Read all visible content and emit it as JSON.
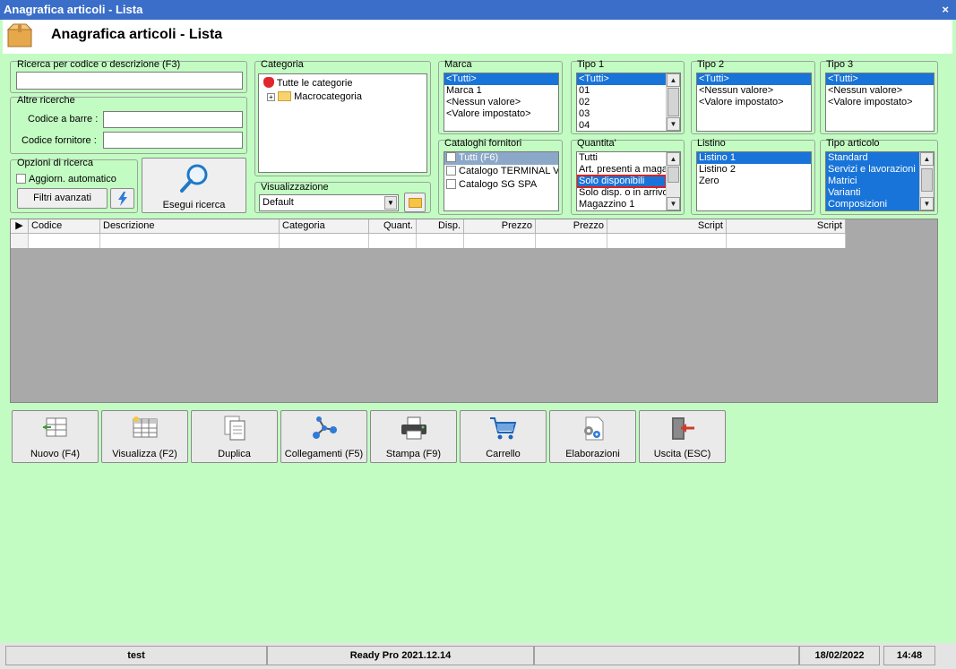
{
  "window": {
    "title": "Anagrafica articoli  - Lista",
    "close": "×",
    "page_title": "Anagrafica articoli  - Lista"
  },
  "search": {
    "label": "Ricerca per codice o descrizione (F3)",
    "value": ""
  },
  "other_search": {
    "title": "Altre ricerche",
    "barcode_label": "Codice a barre :",
    "barcode_value": "",
    "supplier_code_label": "Codice fornitore :",
    "supplier_code_value": ""
  },
  "options": {
    "title": "Opzioni di ricerca",
    "auto_refresh": "Aggiorn. automatico",
    "advanced_filters": "Filtri avanzati",
    "run_search": "Esegui ricerca"
  },
  "category": {
    "title": "Categoria",
    "items": [
      "Tutte le categorie",
      "Macrocategoria"
    ]
  },
  "view": {
    "title": "Visualizzazione",
    "value": "Default"
  },
  "brand": {
    "title": "Marca",
    "items": [
      "<Tutti>",
      "Marca 1",
      "<Nessun valore>",
      "<Valore impostato>"
    ],
    "selected": 0
  },
  "type1": {
    "title": "Tipo 1",
    "items": [
      "<Tutti>",
      "01",
      "02",
      "03",
      "04"
    ],
    "selected": 0
  },
  "type2": {
    "title": "Tipo 2",
    "items": [
      "<Tutti>",
      "<Nessun valore>",
      "<Valore impostato>"
    ],
    "selected": 0
  },
  "type3": {
    "title": "Tipo 3",
    "items": [
      "<Tutti>",
      "<Nessun valore>",
      "<Valore impostato>"
    ],
    "selected": 0
  },
  "catalogs": {
    "title": "Cataloghi fornitori",
    "items": [
      "Tutti (F6)",
      "Catalogo TERMINAL VID",
      "Catalogo SG SPA"
    ],
    "selected": 0
  },
  "quantity": {
    "title": "Quantita'",
    "items": [
      "Tutti",
      "Art. presenti a magaz",
      "Solo disponibili",
      "Solo disp. o in arrivo",
      "Magazzino 1"
    ],
    "selected": 2
  },
  "price_list": {
    "title": "Listino",
    "items": [
      "Listino 1",
      "Listino 2",
      "Zero"
    ],
    "selected": 0
  },
  "article_type": {
    "title": "Tipo articolo",
    "items": [
      "Standard",
      "Servizi e lavorazioni",
      "Matrici",
      "Varianti",
      "Composizioni"
    ]
  },
  "grid": {
    "columns": [
      "Codice",
      "Descrizione",
      "Categoria",
      "Quant.",
      "Disp.",
      "Prezzo",
      "Prezzo",
      "Script",
      "Script"
    ]
  },
  "toolbar": {
    "new": "Nuovo (F4)",
    "view": "Visualizza (F2)",
    "duplicate": "Duplica",
    "links": "Collegamenti (F5)",
    "print": "Stampa (F9)",
    "cart": "Carrello",
    "processing": "Elaborazioni",
    "exit": "Uscita (ESC)"
  },
  "status": {
    "user": "test",
    "app": "Ready Pro 2021.12.14",
    "extra": "",
    "date": "18/02/2022",
    "time": "14:48"
  },
  "colors": {
    "titlebar": "#3a6ec8",
    "background": "#c3fcc3",
    "selection": "#1874d8"
  }
}
